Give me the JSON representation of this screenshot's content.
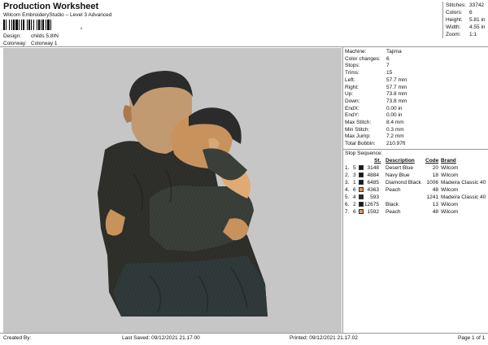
{
  "header": {
    "title": "Production Worksheet",
    "subtitle": "Wilcom EmbroideryStudio – Level 3 Advanced",
    "barcode_glyph": ",",
    "design_label": "Design:",
    "design_value": "childs 5,8IN",
    "colorway_label": "Colorway:",
    "colorway_value": "Colorway 1"
  },
  "summary": {
    "stitches_label": "Stitches:",
    "stitches": "33742",
    "colors_label": "Colors:",
    "colors": "6",
    "height_label": "Height:",
    "height": "5.81 in",
    "width_label": "Width:",
    "width": "4.55 in",
    "zoom_label": "Zoom:",
    "zoom": "1:1"
  },
  "machine_info": [
    {
      "label": "Machine:",
      "value": "Tajima"
    },
    {
      "label": "Color changes:",
      "value": "6"
    },
    {
      "label": "Stops:",
      "value": "7"
    },
    {
      "label": "Trims:",
      "value": "15"
    },
    {
      "label": "Left:",
      "value": "57.7 mm"
    },
    {
      "label": "Right:",
      "value": "57.7 mm"
    },
    {
      "label": "Up:",
      "value": "73.8 mm"
    },
    {
      "label": "Down:",
      "value": "73.8 mm"
    },
    {
      "label": "EndX:",
      "value": "0.00 in"
    },
    {
      "label": "EndY:",
      "value": "0.00 in"
    },
    {
      "label": "Max Stitch:",
      "value": "8.4 mm"
    },
    {
      "label": "Min Stitch:",
      "value": "0.3 mm"
    },
    {
      "label": "Max Jump:",
      "value": "7.2 mm"
    },
    {
      "label": "Total Bobbin:",
      "value": "210.97ft"
    }
  ],
  "stop_sequence": {
    "title": "Stop Sequence:",
    "headers": {
      "st": "St.",
      "description": "Description",
      "code": "Code",
      "brand": "Brand"
    },
    "rows": [
      {
        "stop": "1.",
        "color_no": "5",
        "swatch": "#1a1a1a",
        "st": "3148",
        "description": "Desert Blue",
        "code": "20",
        "brand": "Wilcom"
      },
      {
        "stop": "2.",
        "color_no": "3",
        "swatch": "#1a1a1a",
        "st": "4884",
        "description": "Navy Blue",
        "code": "18",
        "brand": "Wilcom"
      },
      {
        "stop": "3.",
        "color_no": "1",
        "swatch": "#1a1a1a",
        "st": "6485",
        "description": "Diamond Black",
        "code": "1006",
        "brand": "Madeira Classic 40"
      },
      {
        "stop": "4.",
        "color_no": "6",
        "swatch": "#d89a64",
        "st": "4363",
        "description": "Peach",
        "code": "48",
        "brand": "Wilcom"
      },
      {
        "stop": "5.",
        "color_no": "4",
        "swatch": "#2b2b2b",
        "st": "593",
        "description": "",
        "code": "1241",
        "brand": "Madeira Classic 40"
      },
      {
        "stop": "6.",
        "color_no": "2",
        "swatch": "#1a1a1a",
        "st": "12675",
        "description": "Black",
        "code": "13",
        "brand": "Wilcom"
      },
      {
        "stop": "7.",
        "color_no": "6",
        "swatch": "#d89a64",
        "st": "1592",
        "description": "Peach",
        "code": "48",
        "brand": "Wilcom"
      }
    ]
  },
  "footer": {
    "created_by_label": "Created By:",
    "last_saved_label": "Last Saved:",
    "last_saved": "09/12/2021 21.17.00",
    "printed_label": "Printed:",
    "printed": "09/12/2021 21.17.02",
    "page": "Page 1 of 1"
  },
  "colors": {
    "canvas_bg": "#c6c6c6",
    "peach": "#d89a64",
    "black": "#1a1a1a"
  }
}
